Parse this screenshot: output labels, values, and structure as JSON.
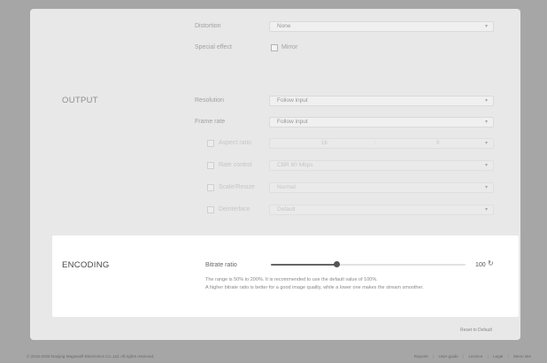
{
  "audio_partial": {
    "row1_label": "Distortion",
    "row1_value": "None",
    "row2_label": "Special effect",
    "row2_checkbox_label": "Mirror"
  },
  "output": {
    "title": "OUTPUT",
    "resolution_label": "Resolution",
    "resolution_value": "Follow input",
    "framerate_label": "Frame rate",
    "framerate_value": "Follow input",
    "aspect_label": "Aspect ratio",
    "aspect_values": [
      "16",
      ":",
      "9"
    ],
    "bitrate_label": "Rate control",
    "bitrate_value": "CBR 80 Mbps",
    "scale_label": "Scale/Resize",
    "scale_value": "Normal",
    "deint_label": "Deinterlace",
    "deint_value": "Default"
  },
  "encoding": {
    "title": "ENCODING",
    "bitrate_ratio_label": "Bitrate ratio",
    "slider_value": 100,
    "slider_max": 200,
    "slider_fraction": 0.5,
    "value_display": "100",
    "help_line1": "The range is 50% to 200%. It is recommended to use the default value of 100%.",
    "help_line2": "A higher bitrate ratio is better for a good image quality, while a lower one makes the stream smoother."
  },
  "revert_label": "Reset to Default",
  "footer": {
    "copyright": "© 2016-2025 Nanjing Magewell Electronics Co.,Ltd. All rights reserved.",
    "links": [
      "Reports",
      "User guide",
      "Licence",
      "Legal",
      "Menu site"
    ]
  }
}
